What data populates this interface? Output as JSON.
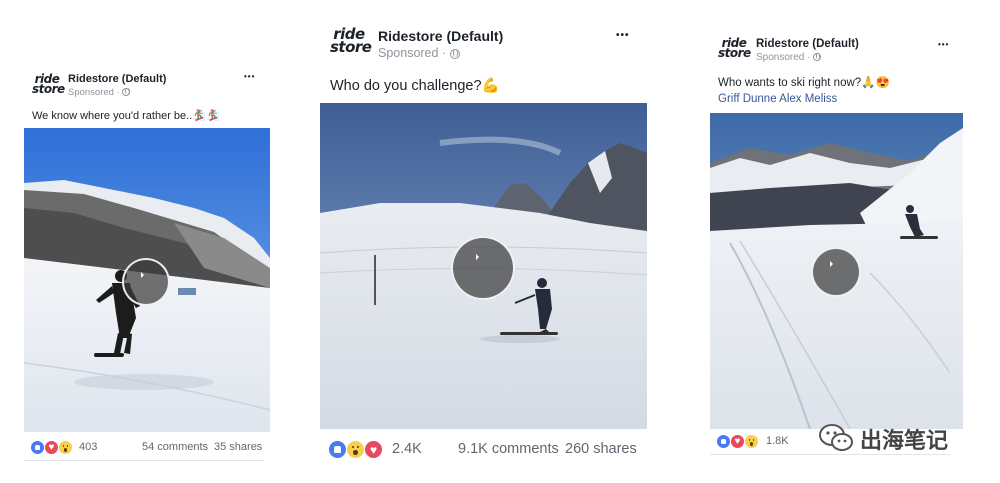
{
  "cards": [
    {
      "page_name": "Ridestore (Default)",
      "sponsored": "Sponsored ·",
      "logo_line1": "ride",
      "logo_line2": "store",
      "more": "•••",
      "caption": "We know where you'd rather be..🏂🏂",
      "reaction_count": "403",
      "comments": "54 comments",
      "shares": "35 shares"
    },
    {
      "page_name": "Ridestore (Default)",
      "sponsored": "Sponsored ·",
      "logo_line1": "ride",
      "logo_line2": "store",
      "more": "•••",
      "caption": "Who do you challenge?💪",
      "reaction_count": "2.4K",
      "comments": "9.1K comments",
      "shares": "260 shares"
    },
    {
      "page_name": "Ridestore (Default)",
      "sponsored": "Sponsored ·",
      "logo_line1": "ride",
      "logo_line2": "store",
      "more": "•••",
      "caption": "Who wants to ski right now?🙏😍",
      "tagged": "Griff Dunne Alex Meliss",
      "reaction_count": "1.8K",
      "comments": "",
      "shares": ""
    }
  ],
  "watermark": {
    "text": "出海笔记",
    "icon": "wechat-icon"
  },
  "colors": {
    "link": "#365899",
    "like": "#4a7bec",
    "love": "#e8495e",
    "wow": "#f7cf4a",
    "muted": "#90949c"
  }
}
